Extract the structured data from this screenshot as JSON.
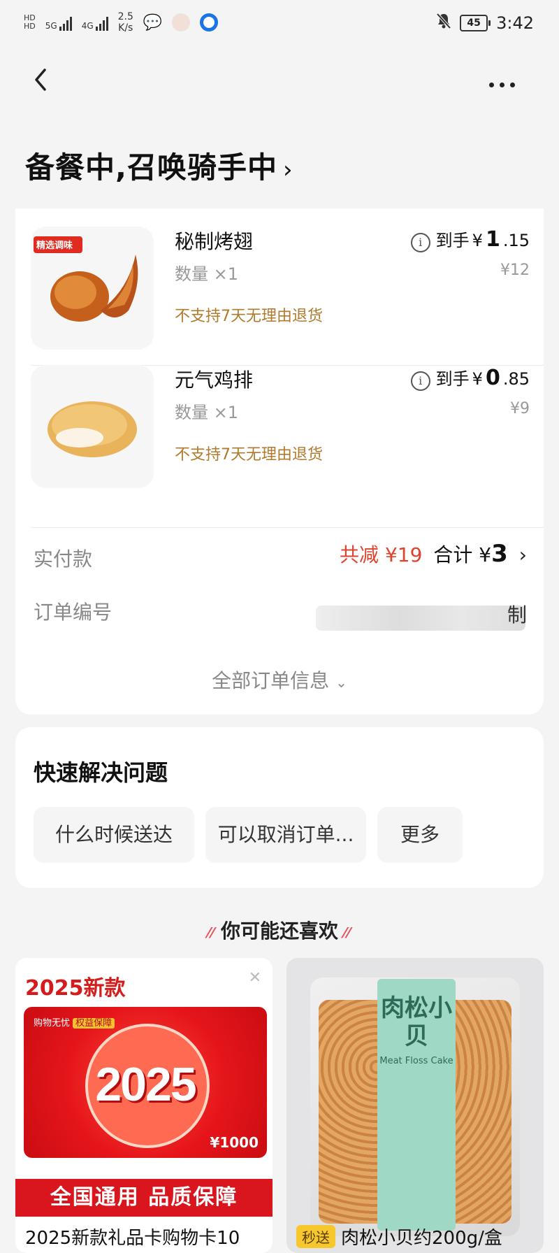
{
  "status_bar": {
    "network1": "5G",
    "network2": "4G",
    "speed_value": "2.5",
    "speed_unit": "K/s",
    "battery": "45",
    "time": "3:42"
  },
  "header": {
    "status_title": "备餐中,召唤骑手中",
    "status_chevron": "›"
  },
  "order": {
    "items": [
      {
        "name": "秘制烤翅",
        "quantity": "数量 ×1",
        "policy": "不支持7天无理由退货",
        "price_prefix": "到手",
        "price_currency": "¥",
        "price_int": "1",
        "price_dec": ".15",
        "original_price": "¥12",
        "thumb_tag": "精选调味"
      },
      {
        "name": "元气鸡排",
        "quantity": "数量 ×1",
        "policy": "不支持7天无理由退货",
        "price_prefix": "到手",
        "price_currency": "¥",
        "price_int": "0",
        "price_dec": ".85",
        "original_price": "¥9"
      }
    ],
    "payment_label": "实付款",
    "discount": "共减 ¥19",
    "total_prefix": "合计 ¥",
    "total_value": "3",
    "order_number_label": "订单编号",
    "order_number_tail": "制",
    "all_info": "全部订单信息"
  },
  "quick": {
    "title": "快速解决问题",
    "buttons": [
      "什么时候送达",
      "可以取消订单...",
      "更多"
    ]
  },
  "recommend": {
    "title": "你可能还喜欢",
    "products": [
      {
        "tag": "2025新款",
        "card_top": "购物无忧",
        "card_top_badge": "权益保障",
        "card_year": "2025",
        "card_value": "¥1000",
        "banner": "全国通用 品质保障",
        "name": "2025新款礼品卡购物卡10"
      },
      {
        "badge": "秒送",
        "label_cn": "肉松小贝",
        "label_en": "Meat Floss Cake",
        "name": "肉松小贝约200g/盒"
      }
    ]
  },
  "colors": {
    "discount": "#e0432d",
    "policy": "#b07a2c",
    "gift_red": "#d9161d"
  }
}
